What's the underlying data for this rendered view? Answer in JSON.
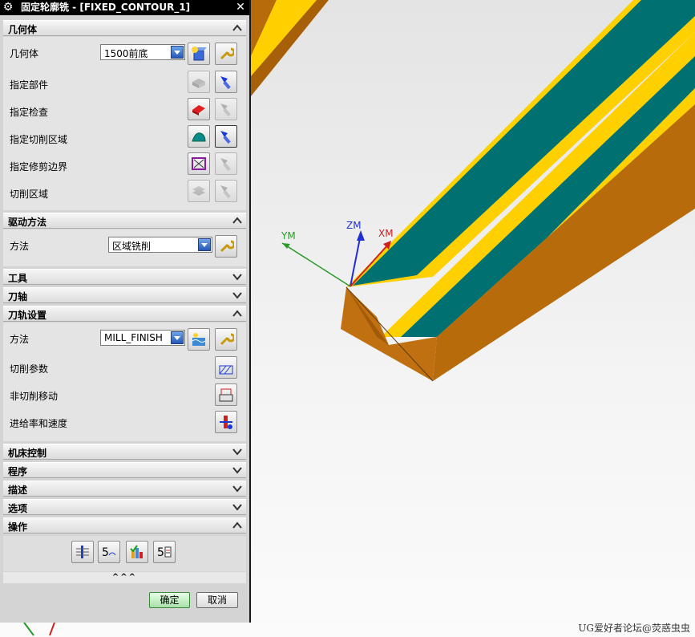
{
  "dialog": {
    "title": "固定轮廓铣 - [FIXED_CONTOUR_1]",
    "sections": {
      "geometry": "几何体",
      "drive_method": "驱动方法",
      "tool": "工具",
      "tool_axis": "刀轴",
      "path_settings": "刀轨设置",
      "machine_control": "机床控制",
      "program": "程序",
      "description": "描述",
      "options": "选项",
      "actions": "操作"
    },
    "geometry": {
      "geometry_label": "几何体",
      "geometry_value": "1500前底",
      "specify_part": "指定部件",
      "specify_check": "指定检查",
      "specify_cut_area": "指定切削区域",
      "specify_trim_boundary": "指定修剪边界",
      "cut_region": "切削区域"
    },
    "drive": {
      "method_label": "方法",
      "method_value": "区域铣削"
    },
    "path": {
      "method_label": "方法",
      "method_value": "MILL_FINISH",
      "cut_params": "切削参数",
      "non_cut_moves": "非切削移动",
      "feeds_speeds": "进给率和速度"
    },
    "more_indicator": "^^^",
    "buttons": {
      "ok": "确定",
      "cancel": "取消"
    }
  },
  "viewport": {
    "axis_labels": {
      "ym": "YM",
      "zm": "ZM",
      "xm": "XM"
    },
    "watermark": "UG爱好者论坛@荧惑虫虫",
    "colors": {
      "orange": "#c07010",
      "yellow": "#ffd000",
      "teal": "#007070"
    }
  }
}
